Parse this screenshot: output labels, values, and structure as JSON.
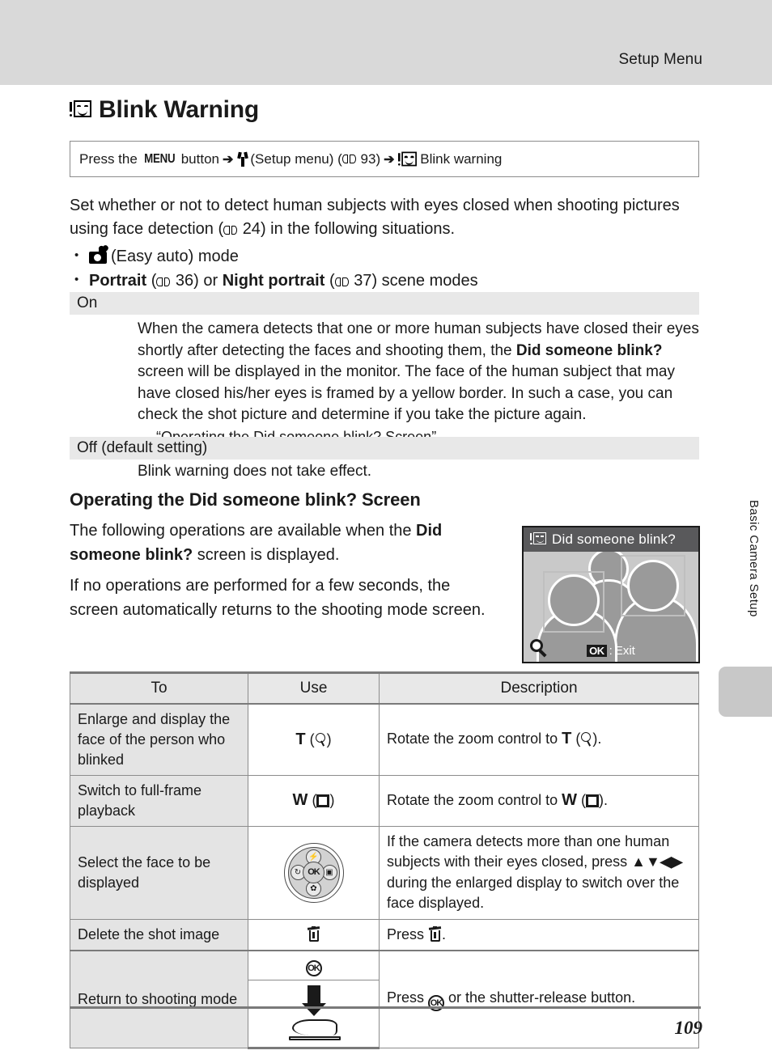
{
  "header": {
    "running_head": "Setup Menu"
  },
  "side_tab": {
    "label": "Basic Camera Setup"
  },
  "chapter": {
    "icon": "blink-warning-icon",
    "title": "Blink Warning"
  },
  "nav_path": {
    "prefix": "Press the",
    "menu_label": "MENU",
    "button_word": "button",
    "arrow": "➔",
    "setup_icon": "wrench-icon",
    "setup_label": "(Setup menu)",
    "book_icon": "book-icon",
    "page_ref": "93",
    "arrow2": "➔",
    "target_icon": "blink-warning-icon",
    "target_label": "Blink warning"
  },
  "intro": {
    "paragraph_part1": "Set whether or not to detect human subjects with eyes closed when shooting pictures using face detection (",
    "book_icon": "book-icon",
    "page_ref": "24",
    "paragraph_part2": ") in the following situations.",
    "bullets": [
      {
        "icon": "easy-auto-icon",
        "text": "(Easy auto) mode"
      },
      {
        "bold1": "Portrait",
        "mid1": "(",
        "page_ref1": "36",
        "mid2": ") or",
        "bold2": "Night portrait",
        "mid3": "(",
        "page_ref2": "37",
        "tail": ") scene modes"
      }
    ]
  },
  "settings": [
    {
      "name": "On",
      "description_html_parts": {
        "p1": "When the camera detects that one or more human subjects have closed their eyes shortly after detecting the faces and shooting them, the ",
        "bold": "Did someone blink?",
        "p2": " screen will be displayed in the monitor. The face of the human subject that may have closed his/her eyes is framed by a yellow border. In such a case, you can check the shot picture and determine if you take the picture again.",
        "cross_ref": "→ “Operating the Did someone blink? Screen”"
      }
    },
    {
      "name": "Off (default setting)",
      "description": "Blink warning does not take effect."
    }
  ],
  "subsection": {
    "heading": "Operating the Did someone blink? Screen",
    "para1_pre": "The following operations are available when the ",
    "para1_bold": "Did someone blink?",
    "para1_post": " screen is displayed.",
    "para2": "If no operations are performed for a few seconds, the screen automatically returns to the shooting mode screen."
  },
  "monitor": {
    "title": "Did someone blink?",
    "title_icon": "blink-warning-icon",
    "magnifier_icon": "magnifier-icon",
    "ok_label": "OK",
    "exit_separator": ":",
    "exit_label": "Exit"
  },
  "op_table": {
    "headers": [
      "To",
      "Use",
      "Description"
    ],
    "rows": [
      {
        "to": "Enlarge and display the face of the person who blinked",
        "use_text": "T",
        "use_icon": "magnifier-icon",
        "desc_pre": "Rotate the zoom control to ",
        "desc_key": "T",
        "desc_icon": "magnifier-icon",
        "desc_post": "."
      },
      {
        "to": "Switch to full-frame playback",
        "use_text": "W",
        "use_icon": "thumbnail-icon",
        "desc_pre": "Rotate the zoom control to ",
        "desc_key": "W",
        "desc_icon": "thumbnail-icon",
        "desc_post": "."
      },
      {
        "to": "Select the face to be displayed",
        "use_icon": "multi-selector-dial-icon",
        "dial": {
          "top": "flash-icon",
          "left": "self-timer-icon",
          "right": "exposure-compensation-icon",
          "bottom": "macro-icon",
          "center": "OK"
        },
        "desc_pre": "If the camera detects more than one human subjects with their eyes closed, press ",
        "desc_arrows": "▲▼◀▶",
        "desc_post": " during the enlarged display to switch over the face displayed."
      },
      {
        "to": "Delete the shot image",
        "use_icon": "trash-icon",
        "desc_pre": "Press ",
        "desc_icon": "trash-icon",
        "desc_post": "."
      },
      {
        "to": "Return to shooting mode",
        "use_icon_1": "ok-button-icon",
        "use_icon_2": "shutter-release-icon",
        "desc_pre": "Press ",
        "desc_icon": "ok-button-icon",
        "desc_post": " or the shutter-release button."
      }
    ]
  },
  "footer": {
    "page_number": "109"
  },
  "colors": {
    "header_band": "#d9d9d9",
    "setting_head": "#e8e8e8",
    "table_col_bg": "#e4e4e4",
    "monitor_titlebar": "#59595b",
    "monitor_bg": "#c9c9c9",
    "side_tab": "#c8c8c8",
    "rule": "#7a7a7a"
  }
}
